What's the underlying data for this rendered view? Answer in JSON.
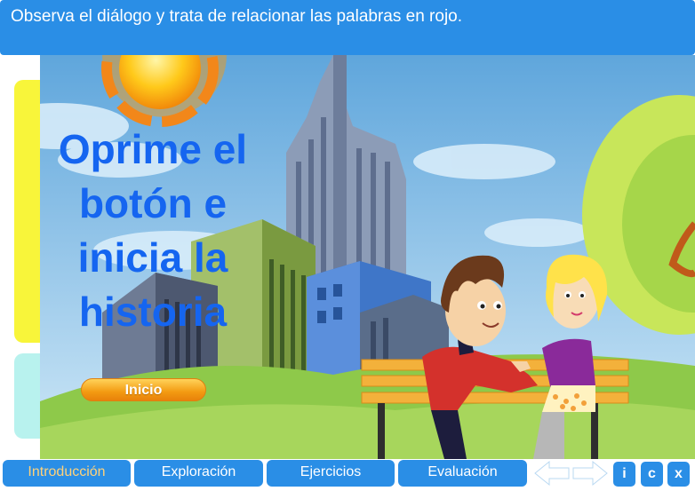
{
  "header": {
    "instruction": "Observa el diálogo y trata de relacionar las palabras en rojo."
  },
  "scene": {
    "prompt_lines": [
      "Oprime el",
      "botón e",
      "inicia la",
      "historia"
    ],
    "start_button": "Inicio"
  },
  "nav": {
    "tabs": [
      {
        "label": "Introducción",
        "active": true
      },
      {
        "label": "Exploración",
        "active": false
      },
      {
        "label": "Ejercicios",
        "active": false
      },
      {
        "label": "Evaluación",
        "active": false
      }
    ],
    "buttons": {
      "info": "i",
      "credits": "c",
      "close": "x"
    }
  },
  "colors": {
    "header_bg": "#2a8ee6",
    "prompt_text": "#1565f0",
    "start_button": "#f39a12",
    "active_tab_text": "#ffd27a"
  },
  "icons": [
    "arrow-left-icon",
    "arrow-right-icon"
  ]
}
